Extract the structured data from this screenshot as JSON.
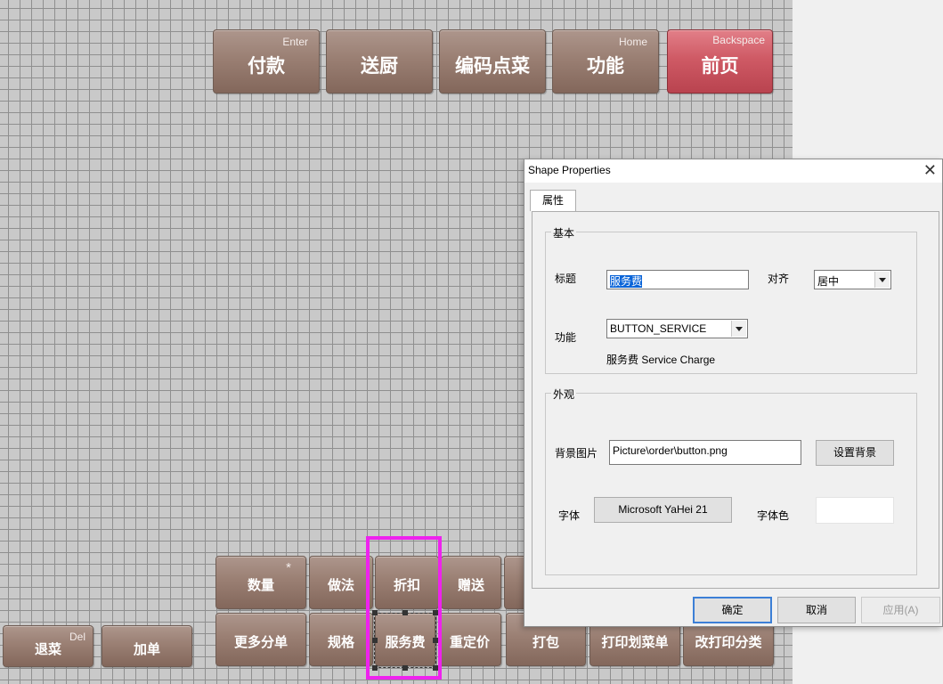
{
  "top_buttons": [
    {
      "label": "付款",
      "hotkey": "Enter"
    },
    {
      "label": "送厨",
      "hotkey": ""
    },
    {
      "label": "编码点菜",
      "hotkey": ""
    },
    {
      "label": "功能",
      "hotkey": "Home"
    },
    {
      "label": "前页",
      "hotkey": "Backspace"
    }
  ],
  "bottom_row1": [
    {
      "label": "数量",
      "hotkey": "*"
    },
    {
      "label": "做法",
      "hotkey": ""
    },
    {
      "label": "折扣",
      "hotkey": ""
    },
    {
      "label": "赠送",
      "hotkey": ""
    }
  ],
  "bottom_row2": [
    {
      "label": "更多分单"
    },
    {
      "label": "规格"
    },
    {
      "label": "服务费"
    },
    {
      "label": "重定价"
    },
    {
      "label": "打包"
    },
    {
      "label": "打印划菜单"
    },
    {
      "label": "改打印分类"
    }
  ],
  "left_buttons": [
    {
      "label": "退菜",
      "hotkey": "Del"
    },
    {
      "label": "加单",
      "hotkey": ""
    }
  ],
  "dialog": {
    "title": "Shape Properties",
    "close_glyph": "✕",
    "tab": "属性",
    "basic_group": "基本",
    "caption_label": "标题",
    "caption_value": "服务费",
    "align_label": "对齐",
    "align_value": "居中",
    "function_label": "功能",
    "function_value": "BUTTON_SERVICE",
    "function_desc": "服务费  Service Charge",
    "appearance_group": "外观",
    "bg_label": "背景图片",
    "bg_value": "Picture\\order\\button.png",
    "set_bg_button": "设置背景",
    "font_label": "字体",
    "font_value": "Microsoft YaHei 21",
    "font_color_label": "字体色",
    "ok_button": "确定",
    "cancel_button": "取消",
    "apply_button": "应用(A)"
  },
  "colors": {
    "selection": "#ee22ee",
    "button_brown": "#9a7f73",
    "button_red": "#cf5a65",
    "grid_bg": "#c9c9c9"
  }
}
